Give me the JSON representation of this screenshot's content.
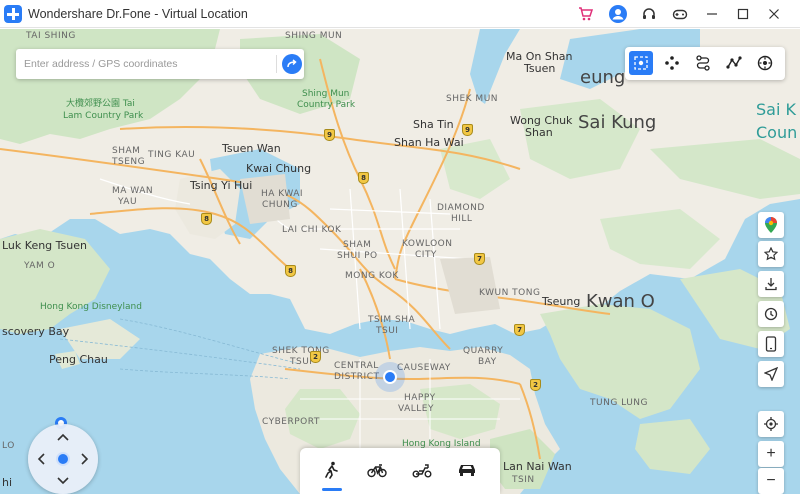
{
  "window": {
    "title": "Wondershare Dr.Fone - Virtual Location",
    "logo_icon": "drfone-plus-icon",
    "buttons": [
      "cart-icon",
      "user-icon",
      "headset-icon",
      "gamepad-icon",
      "minimize-icon",
      "maximize-icon",
      "close-icon"
    ]
  },
  "search": {
    "placeholder": "Enter address / GPS coordinates",
    "value": "",
    "go_icon": "arrow-right-icon"
  },
  "modes": [
    {
      "name": "teleport-mode",
      "icon": "teleport-icon",
      "active": true
    },
    {
      "name": "two-spot-mode",
      "icon": "two-spot-icon",
      "active": false
    },
    {
      "name": "multi-spot-mode",
      "icon": "route-icon",
      "active": false
    },
    {
      "name": "jump-mode",
      "icon": "jump-route-icon",
      "active": false
    },
    {
      "name": "joystick-mode",
      "icon": "joystick-icon",
      "active": false
    }
  ],
  "side_tools": [
    "google-maps-icon",
    "favorite-star-icon",
    "import-icon",
    "history-clock-icon",
    "phone-icon",
    "navigate-icon",
    "locate-center-icon",
    "zoom-in-icon",
    "zoom-out-icon"
  ],
  "zoom": {
    "in_label": "+",
    "out_label": "−"
  },
  "travel_modes": [
    "walking-icon",
    "cycling-icon",
    "scooter-icon",
    "car-icon"
  ],
  "map": {
    "labels": {
      "tai_shing": "TAI SHING",
      "shing_mun": "SHING MUN",
      "ma_on_shan": "Ma On Shan",
      "tsuen": "Tsuen",
      "cheung": "eung",
      "sai_kung_east": "Sai K",
      "coun": "Coun",
      "tai_lam": "大欖郊野公園 Tai",
      "tai_lam2": "Lam Country Park",
      "shing_mun_park": "Shing Mun",
      "shing_mun_park2": "Country Park",
      "shek_mun": "SHEK MUN",
      "sha_tin": "Sha Tin",
      "shan_ha_wai": "Shan Ha Wai",
      "wong_chuk": "Wong Chuk",
      "shan": "Shan",
      "sai_kung": "Sai Kung",
      "tsuen_wan": "Tsuen Wan",
      "sham_tseng": "SHAM",
      "tseng": "TSENG",
      "ting_kau": "TING KAU",
      "kwai_chung": "Kwai Chung",
      "tsing_yi_hui": "Tsing Yi Hui",
      "ha_kwai_chung": "HA KWAI",
      "chung": "CHUNG",
      "ma_wan": "MA WAN",
      "ma_wan2": "YAU",
      "diamond": "DIAMOND",
      "hill": "HILL",
      "lai_chi_kok": "LAI CHI KOK",
      "sham_shui_po": "SHAM",
      "shui_po": "SHUI PO",
      "kowloon": "KOWLOON",
      "city": "CITY",
      "luk_keng": "Luk Keng Tsuen",
      "yam_o": "YAM O",
      "mong_kok": "MONG KOK",
      "kwun_tong": "KWUN TONG",
      "tseung": "Tseung",
      "kwan_o": "Kwan O",
      "hk_disneyland": "Hong Kong Disneyland",
      "discovery_bay": "scovery Bay",
      "tsim_sha": "TSIM SHA",
      "tsui": "TSUI",
      "peng_chau": "Peng Chau",
      "sheung_wan": "SHEK TONG",
      "tsui2": "TSUI",
      "central": "CENTRAL",
      "district": "DISTRICT",
      "causeway": "CAUSEWAY",
      "quarry": "QUARRY",
      "bay": "BAY",
      "happy": "HAPPY",
      "valley": "VALLEY",
      "cyberport": "CYBERPORT",
      "hk_island": "Hong Kong Island",
      "lan_nai_wan": "Lan Nai Wan",
      "tsin": "TSIN",
      "tung_lung": "TUNG LUNG",
      "lo": "LO",
      "hi": "hi"
    },
    "shields": [
      "9",
      "9",
      "8",
      "8",
      "8",
      "7",
      "7",
      "2",
      "2"
    ]
  }
}
